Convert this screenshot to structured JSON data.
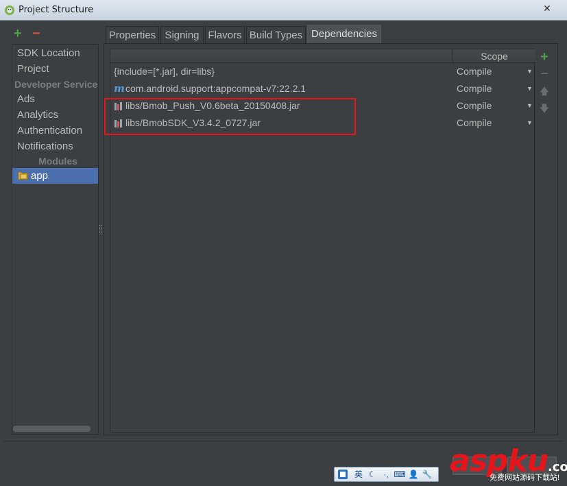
{
  "window": {
    "title": "Project Structure",
    "close_glyph": "✕"
  },
  "left_toolbar": {
    "add_glyph": "+",
    "remove_glyph": "−"
  },
  "sidebar": {
    "items": [
      {
        "label": "SDK Location"
      },
      {
        "label": "Project"
      }
    ],
    "developer_services_header": "Developer Service",
    "developer_services": [
      {
        "label": "Ads"
      },
      {
        "label": "Analytics"
      },
      {
        "label": "Authentication"
      },
      {
        "label": "Notifications"
      }
    ],
    "modules_header": "Modules",
    "modules": [
      {
        "label": "app",
        "selected": true
      }
    ]
  },
  "tabs": [
    {
      "label": "Properties"
    },
    {
      "label": "Signing"
    },
    {
      "label": "Flavors"
    },
    {
      "label": "Build Types"
    },
    {
      "label": "Dependencies",
      "active": true
    }
  ],
  "dependencies": {
    "header": {
      "scope": "Scope"
    },
    "rows": [
      {
        "icon": "none",
        "name": "{include=[*.jar], dir=libs}",
        "scope": "Compile"
      },
      {
        "icon": "maven",
        "icon_glyph": "m",
        "name": "com.android.support:appcompat-v7:22.2.1",
        "scope": "Compile"
      },
      {
        "icon": "jar",
        "name": "libs/Bmob_Push_V0.6beta_20150408.jar",
        "scope": "Compile"
      },
      {
        "icon": "jar",
        "name": "libs/BmobSDK_V3.4.2_0727.jar",
        "scope": "Compile"
      }
    ],
    "dropdown_glyph": "▼"
  },
  "right_toolbar": {
    "add_glyph": "+",
    "remove_glyph": "−",
    "up_glyph": "🡅",
    "down_glyph": "🡇"
  },
  "ime": {
    "items": [
      "英",
      "☾",
      "·,",
      "⌨",
      "👤",
      "🔧"
    ]
  },
  "watermark": {
    "brand": "aspku",
    "suffix": ".com",
    "tagline": "免费网站源码下载站!"
  },
  "colors": {
    "accent_selection": "#4b6eaf",
    "highlight_box": "#e8141c",
    "add_green": "#4ca24c",
    "remove_red": "#d9523e"
  }
}
